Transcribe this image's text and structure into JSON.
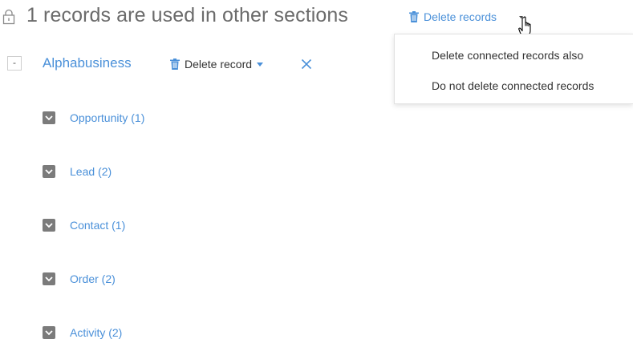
{
  "header": {
    "title": "1 records are used in other sections",
    "delete_records_label": "Delete records"
  },
  "dropdown": {
    "items": [
      {
        "label": "Delete connected records also"
      },
      {
        "label": "Do not delete connected records"
      }
    ]
  },
  "record": {
    "collapse_symbol": "-",
    "name": "Alphabusiness",
    "delete_record_label": "Delete record"
  },
  "linked_sections": [
    {
      "label": "Opportunity (1)"
    },
    {
      "label": "Lead (2)"
    },
    {
      "label": "Contact (1)"
    },
    {
      "label": "Order (2)"
    },
    {
      "label": "Activity (2)"
    }
  ],
  "colors": {
    "accent": "#4a90d9",
    "title_text": "#6b6b6b",
    "chevron_box": "#7b7b7b"
  }
}
